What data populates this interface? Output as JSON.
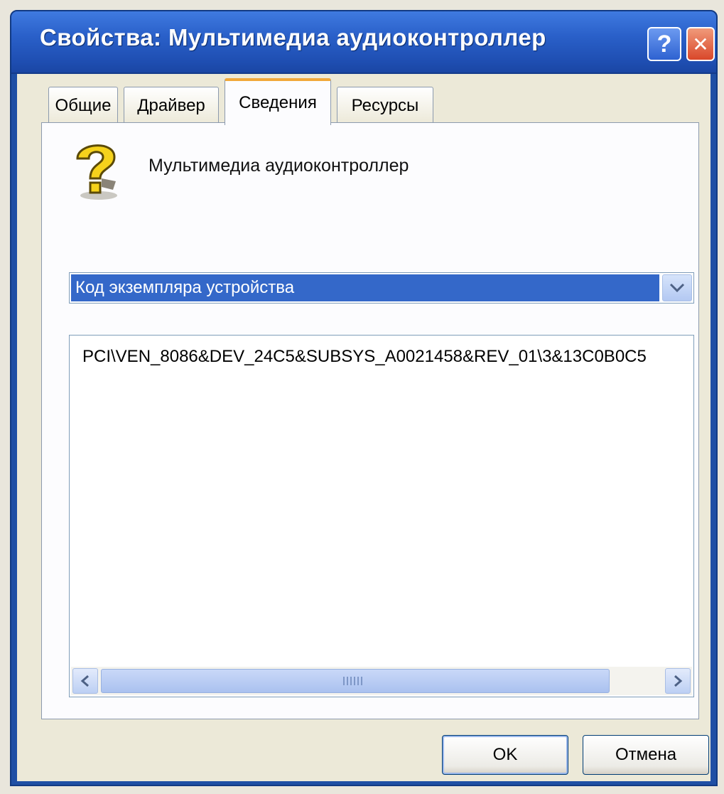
{
  "window": {
    "title": "Свойства: Мультимедиа аудиоконтроллер",
    "help_label": "?",
    "close_label": "✕"
  },
  "tabs": [
    {
      "label": "Общие",
      "active": false
    },
    {
      "label": "Драйвер",
      "active": false
    },
    {
      "label": "Сведения",
      "active": true
    },
    {
      "label": "Ресурсы",
      "active": false
    }
  ],
  "device": {
    "name": "Мультимедиа аудиоконтроллер",
    "icon": "unknown-device-question-icon"
  },
  "property_select": {
    "selected": "Код экземпляра устройства",
    "arrow_icon": "chevron-down-icon"
  },
  "value_list": {
    "items": [
      "PCI\\VEN_8086&DEV_24C5&SUBSYS_A0021458&REV_01\\3&13C0B0C5"
    ]
  },
  "scrollbar": {
    "left_icon": "scroll-left-icon",
    "right_icon": "scroll-right-icon"
  },
  "buttons": {
    "ok_label": "OK",
    "cancel_label": "Отмена"
  },
  "colors": {
    "titlebar": "#2a60c9",
    "selection": "#3468c9",
    "active_tab_accent": "#f1a83a",
    "close_button": "#d9472a"
  }
}
